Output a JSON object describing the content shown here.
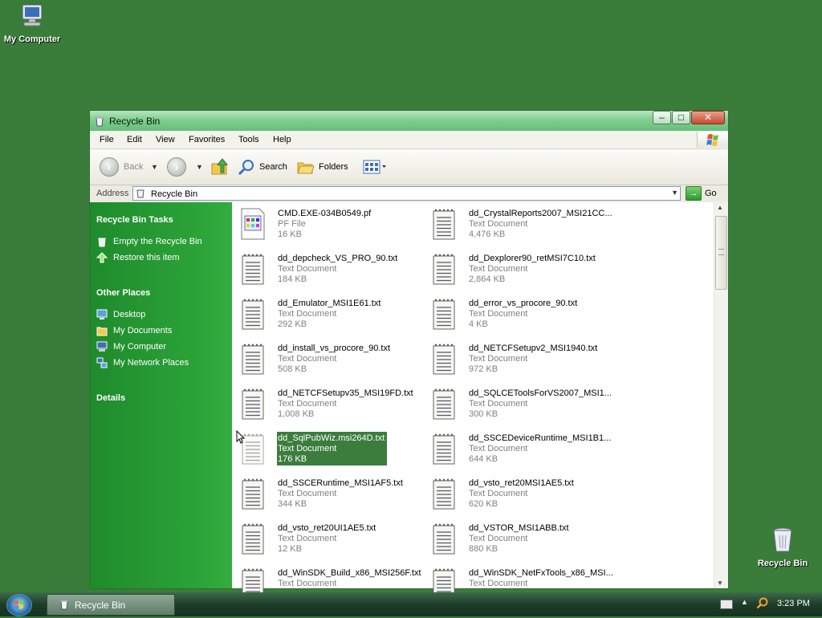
{
  "desktop": {
    "icons": [
      {
        "label": "My Computer"
      },
      {
        "label": "Recycle Bin"
      }
    ]
  },
  "window": {
    "title": "Recycle Bin",
    "controls": {
      "minimize": "▭",
      "maximize": "▢",
      "close": "✕"
    },
    "menu": [
      "File",
      "Edit",
      "View",
      "Favorites",
      "Tools",
      "Help"
    ],
    "toolbar": {
      "back": "Back",
      "search": "Search",
      "folders": "Folders"
    },
    "address": {
      "label": "Address",
      "value": "Recycle Bin",
      "go": "Go"
    },
    "left_pane": {
      "tasks_header": "Recycle Bin Tasks",
      "tasks": [
        "Empty the Recycle Bin",
        "Restore this item"
      ],
      "places_header": "Other Places",
      "places": [
        "Desktop",
        "My Documents",
        "My Computer",
        "My Network Places"
      ],
      "details_header": "Details"
    },
    "files": [
      {
        "name": "CMD.EXE-034B0549.pf",
        "type": "PF File",
        "size": "16 KB",
        "icon": "pf-file-icon"
      },
      {
        "name": "dd_CrystalReports2007_MSI21CC...",
        "type": "Text Document",
        "size": "4,476 KB",
        "icon": "text-file-icon"
      },
      {
        "name": "dd_depcheck_VS_PRO_90.txt",
        "type": "Text Document",
        "size": "184 KB",
        "icon": "text-file-icon"
      },
      {
        "name": "dd_Dexplorer90_retMSI7C10.txt",
        "type": "Text Document",
        "size": "2,864 KB",
        "icon": "text-file-icon"
      },
      {
        "name": "dd_Emulator_MSI1E61.txt",
        "type": "Text Document",
        "size": "292 KB",
        "icon": "text-file-icon"
      },
      {
        "name": "dd_error_vs_procore_90.txt",
        "type": "Text Document",
        "size": "4 KB",
        "icon": "text-file-icon"
      },
      {
        "name": "dd_install_vs_procore_90.txt",
        "type": "Text Document",
        "size": "508 KB",
        "icon": "text-file-icon"
      },
      {
        "name": "dd_NETCFSetupv2_MSI1940.txt",
        "type": "Text Document",
        "size": "972 KB",
        "icon": "text-file-icon"
      },
      {
        "name": "dd_NETCFSetupv35_MSI19FD.txt",
        "type": "Text Document",
        "size": "1,008 KB",
        "icon": "text-file-icon"
      },
      {
        "name": "dd_SQLCEToolsForVS2007_MSI1...",
        "type": "Text Document",
        "size": "300 KB",
        "icon": "text-file-icon"
      },
      {
        "name": "dd_SqlPubWiz.msi264D.txt",
        "type": "Text Document",
        "size": "176 KB",
        "icon": "text-file-icon",
        "selected": true
      },
      {
        "name": "dd_SSCEDeviceRuntime_MSI1B1...",
        "type": "Text Document",
        "size": "644 KB",
        "icon": "text-file-icon"
      },
      {
        "name": "dd_SSCERuntime_MSI1AF5.txt",
        "type": "Text Document",
        "size": "344 KB",
        "icon": "text-file-icon"
      },
      {
        "name": "dd_vsto_ret20MSI1AE5.txt",
        "type": "Text Document",
        "size": "620 KB",
        "icon": "text-file-icon"
      },
      {
        "name": "dd_vsto_ret20UI1AE5.txt",
        "type": "Text Document",
        "size": "12 KB",
        "icon": "text-file-icon"
      },
      {
        "name": "dd_VSTOR_MSI1ABB.txt",
        "type": "Text Document",
        "size": "880 KB",
        "icon": "text-file-icon"
      },
      {
        "name": "dd_WinSDK_Build_x86_MSI256F.txt",
        "type": "Text Document",
        "size": "",
        "icon": "text-file-icon"
      },
      {
        "name": "dd_WinSDK_NetFxTools_x86_MSI...",
        "type": "Text Document",
        "size": "",
        "icon": "text-file-icon"
      }
    ]
  },
  "taskbar": {
    "task": "Recycle Bin",
    "clock": "3:23 PM"
  },
  "colors": {
    "desktop": "#3a7d3a",
    "left_pane": "#2aa137",
    "selection": "#3c7d3e",
    "titlebar": "#7fcf91"
  }
}
